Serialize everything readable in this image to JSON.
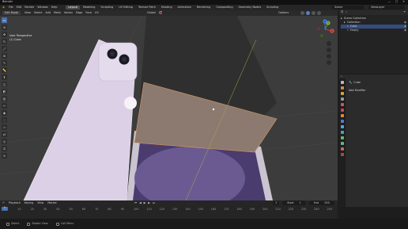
{
  "titlebar": {
    "title": "Blender"
  },
  "menu": [
    "File",
    "Edit",
    "Render",
    "Window",
    "Help"
  ],
  "workspaces": [
    "Layout",
    "Modeling",
    "Sculpting",
    "UV Editing",
    "Texture Paint",
    "Shading",
    "Animation",
    "Rendering",
    "Compositing",
    "Geometry Nodes",
    "Scripting"
  ],
  "active_workspace": "Layout",
  "scene": "Scene",
  "view_layer": "ViewLayer",
  "viewport_header": {
    "mode": "Edit Mode",
    "menus": [
      "View",
      "Select",
      "Add",
      "Mesh",
      "Vertex",
      "Edge",
      "Face",
      "UV"
    ],
    "transform": "Global",
    "options": "Options"
  },
  "viewport_info": {
    "line1": "User Perspective",
    "line2": "(1) Cube"
  },
  "gizmo": {
    "x": "X",
    "y": "Y",
    "z": "Z"
  },
  "outliner": {
    "rows": [
      {
        "label": "Scene Collection",
        "indent": 0,
        "selected": false
      },
      {
        "label": "Collection",
        "indent": 1,
        "selected": false
      },
      {
        "label": "Cube",
        "indent": 2,
        "selected": true
      },
      {
        "label": "Empty",
        "indent": 2,
        "selected": false
      }
    ]
  },
  "properties": {
    "object_name": "Cube",
    "add_modifier": "Add Modifier"
  },
  "timeline_header": {
    "menus": [
      "Playback",
      "Keying",
      "View",
      "Marker"
    ],
    "start_label": "Start",
    "start": "1",
    "end_label": "End",
    "end": "250"
  },
  "timeline": {
    "current_frame": "1",
    "ticks": [
      "0",
      "10",
      "20",
      "30",
      "40",
      "50",
      "60",
      "70",
      "80",
      "90",
      "100",
      "110",
      "120",
      "130",
      "140",
      "150",
      "160",
      "170",
      "180",
      "190",
      "200",
      "210",
      "220",
      "230",
      "240",
      "250"
    ]
  },
  "statusbar": {
    "hint1": "Select",
    "hint2": "Rotate View",
    "hint3": "Call Menu",
    "version": ""
  },
  "colors": {
    "accent": "#4772b3",
    "phone_body": "#dcd0e6",
    "phone_screen": "#5a4b80",
    "plane": "#8c7a70"
  }
}
